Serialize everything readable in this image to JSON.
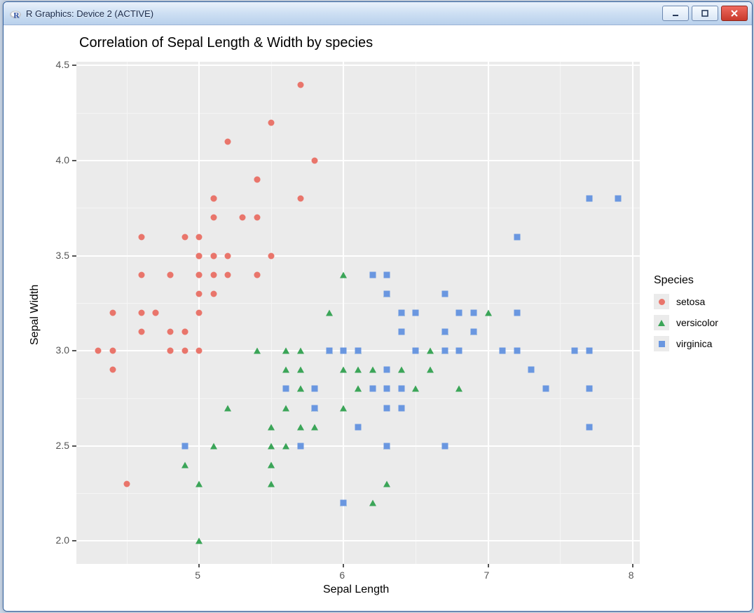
{
  "window": {
    "title": "R Graphics: Device 2 (ACTIVE)",
    "icon_letter": "R"
  },
  "chart_data": {
    "type": "scatter",
    "title": "Correlation of Sepal Length & Width by species",
    "xlabel": "Sepal Length",
    "ylabel": "Sepal Width",
    "xlim": [
      4.15,
      8.05
    ],
    "ylim": [
      1.88,
      4.52
    ],
    "x_ticks": [
      5,
      6,
      7,
      8
    ],
    "y_ticks": [
      2.0,
      2.5,
      3.0,
      3.5,
      4.0,
      4.5
    ],
    "x_minor": [
      4.5,
      5.5,
      6.5,
      7.5
    ],
    "y_minor": [
      2.25,
      2.75,
      3.25,
      3.75,
      4.25
    ],
    "legend_title": "Species",
    "series": [
      {
        "name": "setosa",
        "shape": "circle",
        "color": "#e9756b",
        "points": [
          [
            5.1,
            3.5
          ],
          [
            4.9,
            3.0
          ],
          [
            4.7,
            3.2
          ],
          [
            4.6,
            3.1
          ],
          [
            5.0,
            3.6
          ],
          [
            5.4,
            3.9
          ],
          [
            4.6,
            3.4
          ],
          [
            5.0,
            3.4
          ],
          [
            4.4,
            2.9
          ],
          [
            4.9,
            3.1
          ],
          [
            5.4,
            3.7
          ],
          [
            4.8,
            3.4
          ],
          [
            4.8,
            3.0
          ],
          [
            4.3,
            3.0
          ],
          [
            5.8,
            4.0
          ],
          [
            5.7,
            4.4
          ],
          [
            5.4,
            3.9
          ],
          [
            5.1,
            3.5
          ],
          [
            5.7,
            3.8
          ],
          [
            5.1,
            3.8
          ],
          [
            5.4,
            3.4
          ],
          [
            5.1,
            3.7
          ],
          [
            4.6,
            3.6
          ],
          [
            5.1,
            3.3
          ],
          [
            4.8,
            3.4
          ],
          [
            5.0,
            3.0
          ],
          [
            5.0,
            3.4
          ],
          [
            5.2,
            3.5
          ],
          [
            5.2,
            3.4
          ],
          [
            4.7,
            3.2
          ],
          [
            4.8,
            3.1
          ],
          [
            5.4,
            3.4
          ],
          [
            5.2,
            4.1
          ],
          [
            5.5,
            4.2
          ],
          [
            4.9,
            3.1
          ],
          [
            5.0,
            3.2
          ],
          [
            5.5,
            3.5
          ],
          [
            4.9,
            3.6
          ],
          [
            4.4,
            3.0
          ],
          [
            5.1,
            3.4
          ],
          [
            5.0,
            3.5
          ],
          [
            4.5,
            2.3
          ],
          [
            4.4,
            3.2
          ],
          [
            5.0,
            3.5
          ],
          [
            5.1,
            3.8
          ],
          [
            4.8,
            3.0
          ],
          [
            5.1,
            3.8
          ],
          [
            4.6,
            3.2
          ],
          [
            5.3,
            3.7
          ],
          [
            5.0,
            3.3
          ]
        ]
      },
      {
        "name": "versicolor",
        "shape": "triangle",
        "color": "#3ba558",
        "points": [
          [
            7.0,
            3.2
          ],
          [
            6.4,
            3.2
          ],
          [
            6.9,
            3.1
          ],
          [
            5.5,
            2.3
          ],
          [
            6.5,
            2.8
          ],
          [
            5.7,
            2.8
          ],
          [
            6.3,
            3.3
          ],
          [
            4.9,
            2.4
          ],
          [
            6.6,
            2.9
          ],
          [
            5.2,
            2.7
          ],
          [
            5.0,
            2.0
          ],
          [
            5.9,
            3.0
          ],
          [
            6.0,
            2.2
          ],
          [
            6.1,
            2.9
          ],
          [
            5.6,
            2.9
          ],
          [
            6.7,
            3.1
          ],
          [
            5.6,
            3.0
          ],
          [
            5.8,
            2.7
          ],
          [
            6.2,
            2.2
          ],
          [
            5.6,
            2.5
          ],
          [
            5.9,
            3.2
          ],
          [
            6.1,
            2.8
          ],
          [
            6.3,
            2.5
          ],
          [
            6.1,
            2.8
          ],
          [
            6.4,
            2.9
          ],
          [
            6.6,
            3.0
          ],
          [
            6.8,
            2.8
          ],
          [
            6.7,
            3.0
          ],
          [
            6.0,
            2.9
          ],
          [
            5.7,
            2.6
          ],
          [
            5.5,
            2.4
          ],
          [
            5.5,
            2.4
          ],
          [
            5.8,
            2.7
          ],
          [
            6.0,
            2.7
          ],
          [
            5.4,
            3.0
          ],
          [
            6.0,
            3.4
          ],
          [
            6.7,
            3.1
          ],
          [
            6.3,
            2.3
          ],
          [
            5.6,
            3.0
          ],
          [
            5.5,
            2.5
          ],
          [
            5.5,
            2.6
          ],
          [
            6.1,
            3.0
          ],
          [
            5.8,
            2.6
          ],
          [
            5.0,
            2.3
          ],
          [
            5.6,
            2.7
          ],
          [
            5.7,
            3.0
          ],
          [
            5.7,
            2.9
          ],
          [
            6.2,
            2.9
          ],
          [
            5.1,
            2.5
          ],
          [
            5.7,
            2.8
          ]
        ]
      },
      {
        "name": "virginica",
        "shape": "square",
        "color": "#6a97e0",
        "points": [
          [
            6.3,
            3.3
          ],
          [
            5.8,
            2.7
          ],
          [
            7.1,
            3.0
          ],
          [
            6.3,
            2.9
          ],
          [
            6.5,
            3.0
          ],
          [
            7.6,
            3.0
          ],
          [
            4.9,
            2.5
          ],
          [
            7.3,
            2.9
          ],
          [
            6.7,
            2.5
          ],
          [
            7.2,
            3.6
          ],
          [
            6.5,
            3.2
          ],
          [
            6.4,
            2.7
          ],
          [
            6.8,
            3.0
          ],
          [
            5.7,
            2.5
          ],
          [
            5.8,
            2.8
          ],
          [
            6.4,
            3.2
          ],
          [
            6.5,
            3.0
          ],
          [
            7.7,
            3.8
          ],
          [
            7.7,
            2.6
          ],
          [
            6.0,
            2.2
          ],
          [
            6.9,
            3.2
          ],
          [
            5.6,
            2.8
          ],
          [
            7.7,
            2.8
          ],
          [
            6.3,
            2.7
          ],
          [
            6.7,
            3.3
          ],
          [
            7.2,
            3.2
          ],
          [
            6.2,
            2.8
          ],
          [
            6.1,
            3.0
          ],
          [
            6.4,
            2.8
          ],
          [
            7.2,
            3.0
          ],
          [
            7.4,
            2.8
          ],
          [
            7.9,
            3.8
          ],
          [
            6.4,
            2.8
          ],
          [
            6.3,
            2.8
          ],
          [
            6.1,
            2.6
          ],
          [
            7.7,
            3.0
          ],
          [
            6.3,
            3.4
          ],
          [
            6.4,
            3.1
          ],
          [
            6.0,
            3.0
          ],
          [
            6.9,
            3.1
          ],
          [
            6.7,
            3.1
          ],
          [
            6.9,
            3.1
          ],
          [
            5.8,
            2.7
          ],
          [
            6.8,
            3.2
          ],
          [
            6.7,
            3.3
          ],
          [
            6.7,
            3.0
          ],
          [
            6.3,
            2.5
          ],
          [
            6.5,
            3.0
          ],
          [
            6.2,
            3.4
          ],
          [
            5.9,
            3.0
          ]
        ]
      }
    ]
  },
  "legend": {
    "items": [
      "setosa",
      "versicolor",
      "virginica"
    ]
  }
}
